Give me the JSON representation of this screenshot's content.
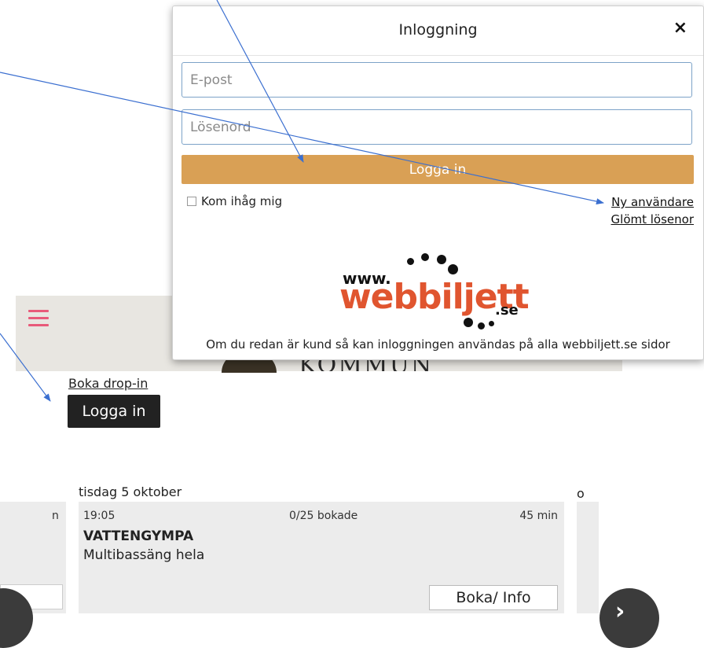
{
  "background": {
    "header_logo_text": "KOMMUN",
    "boka_drop_in": "Boka drop-in",
    "login_button": "Logga in",
    "day": "tisdag 5 oktober",
    "right_day_fragment": "o",
    "left_card_fragment": "n",
    "session": {
      "time": "19:05",
      "booked": "0/25 bokade",
      "duration": "45 min",
      "title": "VATTENGYMPA",
      "venue": "Multibassäng hela",
      "info_button": "Boka/ Info"
    },
    "nav_right_glyph": "›"
  },
  "modal": {
    "title": "Inloggning",
    "close_glyph": "×",
    "email_placeholder": "E-post",
    "password_placeholder": "Lösenord",
    "submit_label": "Logga in",
    "remember_label": "Kom ihåg mig",
    "new_user_link": "Ny användare",
    "forgot_link": "Glömt lösenor",
    "brand": {
      "www": "www.",
      "main": "webbiljett",
      "tld": ".se"
    },
    "footer_note": "Om du redan är kund så kan inloggningen användas på alla webbiljett.se sidor"
  },
  "colors": {
    "accent_button": "#d9a055",
    "brand_red": "#e0552f",
    "hamburger": "#e85a7a",
    "arrow": "#3b6fd0"
  }
}
